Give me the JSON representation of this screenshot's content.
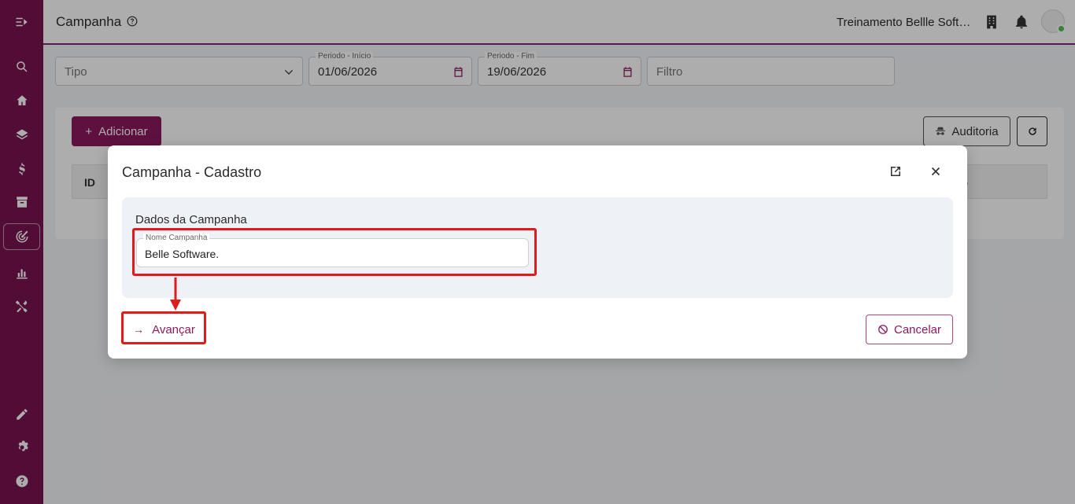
{
  "header": {
    "title": "Campanha",
    "user_name": "Treinamento Bellle Software"
  },
  "sidebar": {
    "items": [
      {
        "name": "menu-toggle",
        "icon": "menu-arrow-icon"
      },
      {
        "name": "search",
        "icon": "search-icon"
      },
      {
        "name": "home",
        "icon": "home-icon"
      },
      {
        "name": "layers",
        "icon": "layers-icon"
      },
      {
        "name": "finance",
        "icon": "dollar-icon"
      },
      {
        "name": "archive",
        "icon": "archive-icon"
      },
      {
        "name": "campaign",
        "icon": "target-icon",
        "active": true
      },
      {
        "name": "reports",
        "icon": "chart-icon"
      },
      {
        "name": "tools",
        "icon": "tools-icon"
      },
      {
        "name": "edit",
        "icon": "pencil-icon"
      },
      {
        "name": "settings",
        "icon": "gear-icon"
      },
      {
        "name": "help",
        "icon": "help-icon"
      }
    ]
  },
  "filters": {
    "tipo_placeholder": "Tipo",
    "periodo_inicio_label": "Periodo - Início",
    "periodo_inicio_value": "01/06/2026",
    "periodo_fim_label": "Periodo - Fim",
    "periodo_fim_value": "19/06/2026",
    "filtro_placeholder": "Filtro"
  },
  "toolbar": {
    "add_label": "Adicionar",
    "audit_label": "Auditoria"
  },
  "table": {
    "columns": [
      "ID",
      "o"
    ]
  },
  "modal": {
    "title": "Campanha - Cadastro",
    "section_title": "Dados da Campanha",
    "name_label": "Nome Campanha",
    "name_value": "Belle Software.",
    "next_label": "Avançar",
    "cancel_label": "Cancelar"
  },
  "colors": {
    "brand": "#7a1450",
    "primary_button": "#8b1a5d",
    "highlight": "#e01b1b",
    "status_online": "#5cb85c"
  }
}
